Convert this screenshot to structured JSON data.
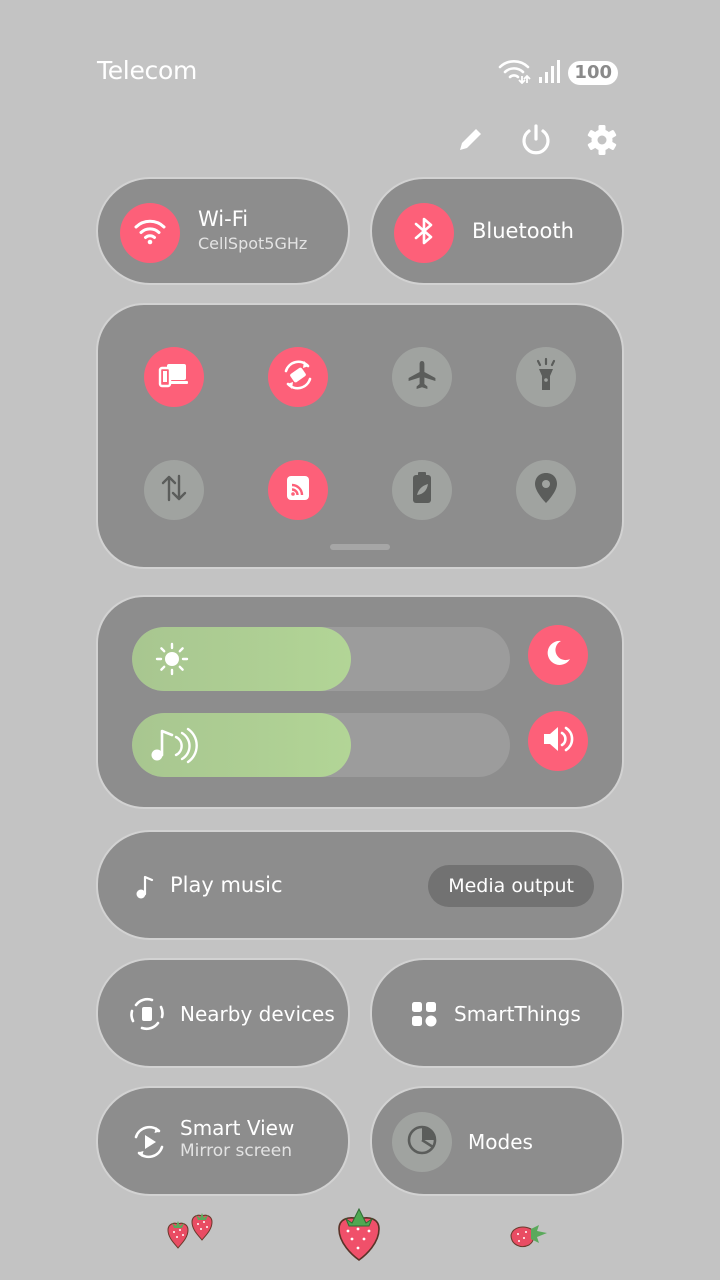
{
  "status_bar": {
    "carrier": "Telecom",
    "battery": "100",
    "icons": [
      "wifi-icon",
      "signal-icon"
    ]
  },
  "top_actions": [
    "edit-icon",
    "power-icon",
    "settings-icon"
  ],
  "tiles": {
    "wifi": {
      "title": "Wi-Fi",
      "subtitle": "CellSpot5GHz",
      "active": true
    },
    "bluetooth": {
      "title": "Bluetooth",
      "active": true
    }
  },
  "quick_toggles": [
    {
      "icon": "screen-share-icon",
      "active": true
    },
    {
      "icon": "auto-rotate-icon",
      "active": true
    },
    {
      "icon": "airplane-icon",
      "active": false
    },
    {
      "icon": "flashlight-icon",
      "active": false
    },
    {
      "icon": "mobile-data-icon",
      "active": false
    },
    {
      "icon": "cast-icon",
      "active": true
    },
    {
      "icon": "power-saving-icon",
      "active": false
    },
    {
      "icon": "location-icon",
      "active": false
    }
  ],
  "sliders": {
    "brightness": {
      "level": 0.58,
      "icon": "sun-icon",
      "side_icon": "moon-icon"
    },
    "volume": {
      "level": 0.58,
      "icon": "music-note-icon",
      "side_icon": "speaker-icon"
    }
  },
  "media": {
    "label": "Play music",
    "output_label": "Media output"
  },
  "bottom_tiles": {
    "nearby": {
      "title": "Nearby devices"
    },
    "smartthings": {
      "title": "SmartThings"
    },
    "smartview": {
      "title": "Smart View",
      "subtitle": "Mirror screen"
    },
    "modes": {
      "title": "Modes"
    }
  },
  "colors": {
    "background": "#c3c3c3",
    "card": "#8d8d8d",
    "accent": "#fd6079",
    "slider_fill": "#b2d596",
    "inactive_button": "#a0a3a0"
  }
}
